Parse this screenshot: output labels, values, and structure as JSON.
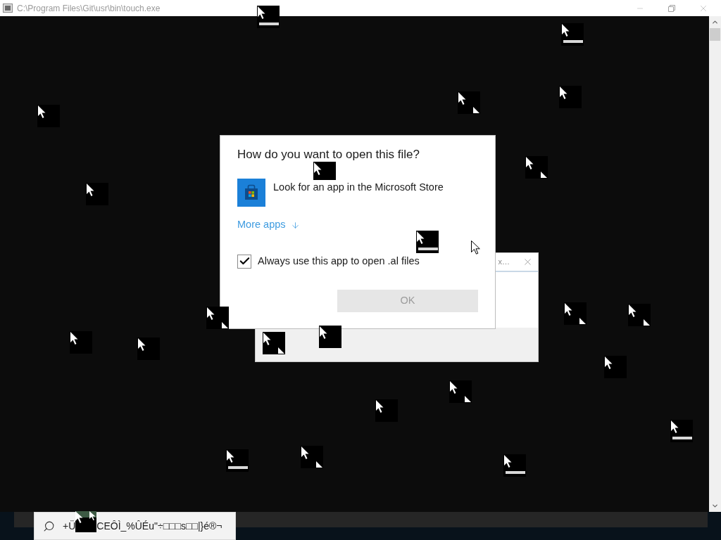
{
  "window": {
    "title": "C:\\Program Files\\Git\\usr\\bin\\touch.exe"
  },
  "back_dialog": {
    "title": "x…"
  },
  "open_with_dialog": {
    "heading": "How do you want to open this file?",
    "store_option": "Look for an app in the Microsoft Store",
    "more_apps_link": "More apps",
    "always_use": {
      "label": "Always use this app to open .al files",
      "checked": true
    },
    "ok_button": {
      "label": "OK",
      "disabled": true
    }
  },
  "taskbar": {
    "search": {
      "value_parts": [
        "+Ü",
        "CEÔÌ_%ÛÉu\"÷□□□s□□|}é®¬"
      ]
    }
  }
}
